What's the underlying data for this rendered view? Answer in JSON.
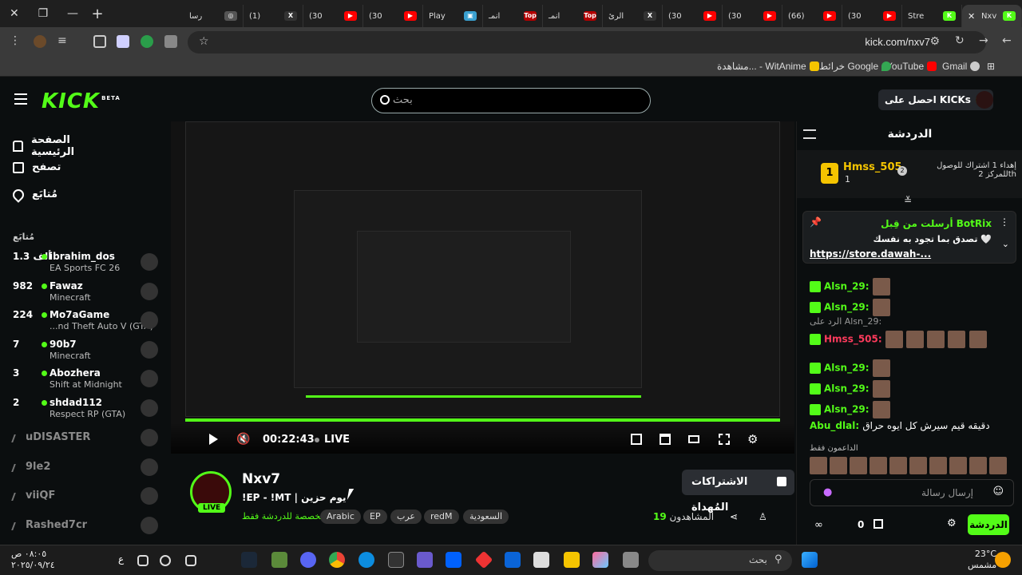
{
  "browser": {
    "tabs": [
      {
        "label": "Nxv",
        "icon": "K",
        "color": "#53fc18",
        "active": true
      },
      {
        "label": "Stre",
        "icon": "K",
        "color": "#53fc18"
      },
      {
        "label": "(30",
        "icon": "▶",
        "color": "#ff0000"
      },
      {
        "label": "(66)",
        "icon": "▶",
        "color": "#ff0000"
      },
      {
        "label": "(30",
        "icon": "▶",
        "color": "#ff0000"
      },
      {
        "label": "(30",
        "icon": "▶",
        "color": "#ff0000"
      },
      {
        "label": "الرئ",
        "icon": "X",
        "color": "#333333"
      },
      {
        "label": "انمـ",
        "icon": "Top",
        "color": "#b30000"
      },
      {
        "label": "انمـ",
        "icon": "Top",
        "color": "#b30000"
      },
      {
        "label": "Play",
        "icon": "▣",
        "color": "#3aa0d0"
      },
      {
        "label": "(30",
        "icon": "▶",
        "color": "#ff0000"
      },
      {
        "label": "(30",
        "icon": "▶",
        "color": "#ff0000"
      },
      {
        "label": "(1)",
        "icon": "X",
        "color": "#333333"
      },
      {
        "label": "رسا",
        "icon": "◎",
        "color": "#555555"
      }
    ],
    "url": "kick.com/nxv7",
    "bookmarks": [
      {
        "label": "Gmail",
        "color": "#cccccc"
      },
      {
        "label": "YouTube",
        "color": "#ff0000"
      },
      {
        "label": "خرائط Google",
        "color": "#34a853"
      },
      {
        "label": "مشاهدة... - WitAnime",
        "color": "#f5c400"
      }
    ]
  },
  "kick": {
    "logo": "KICK",
    "beta": "BETA",
    "search_placeholder": "بحث",
    "get_kicks": "احصل على KICKs"
  },
  "sidebar": {
    "nav": [
      "الصفحة الرئيسية",
      "تصفح",
      "مُتابَع"
    ],
    "following_header": "مُتابَع",
    "live": [
      {
        "name": "ibrahim_dos",
        "count": "1.3 ألف",
        "category": "EA Sports FC 26"
      },
      {
        "name": "Fawaz",
        "count": "982",
        "category": "Minecraft"
      },
      {
        "name": "Mo7aGame",
        "count": "224",
        "category": "...nd Theft Auto V (GTA)"
      },
      {
        "name": "90b7",
        "count": "7",
        "category": "Minecraft"
      },
      {
        "name": "Abozhera",
        "count": "3",
        "category": "Shift at Midnight"
      },
      {
        "name": "shdad112",
        "count": "2",
        "category": "Respect RP (GTA)"
      }
    ],
    "offline": [
      "uDISASTER",
      "9le2",
      "viiQF",
      "Rashed7cr"
    ]
  },
  "player": {
    "time": "00:22:43",
    "live_label": "LIVE"
  },
  "stream": {
    "name": "Nxv7",
    "title": "!EP - !MT | يوم حزين",
    "category": "مخصصة للدردشة فقط",
    "tags": [
      "السعودية",
      "redM",
      "عرب",
      "EP",
      "Arabic"
    ],
    "gift_button": "الاشتراكات المُهداة",
    "viewers_label": "المشاهدون",
    "viewers_count": "19",
    "live_badge": "LIVE"
  },
  "chat": {
    "title": "الدردشة",
    "leader": {
      "name": "Hmss_505",
      "subs": "1",
      "rank": "2",
      "description": "إهداء 1 اشتراك للوصول للمركز 2th"
    },
    "pinned": {
      "author": "BotRix",
      "sent_by": "أرسلت من قِبل",
      "text": "تصدق بما تجود به نفسك 🤍",
      "link": "https://store.dawah-..."
    },
    "messages": [
      {
        "user": "Alsn_29:",
        "color": "#53fc18"
      },
      {
        "user": "Alsn_29:",
        "color": "#53fc18"
      },
      {
        "user": "Hmss_505:",
        "color": "#ff3b5c",
        "reply": "الرد على Alsn_29:"
      },
      {
        "user": "Alsn_29:",
        "color": "#53fc18"
      },
      {
        "user": "Alsn_29:",
        "color": "#53fc18"
      },
      {
        "user": "Alsn_29:",
        "color": "#53fc18"
      },
      {
        "user": "Abu_dlal:",
        "color": "#53fc18",
        "text": "دقيقه قيم سيرش كل ايوه حراق"
      }
    ],
    "supporters_label": "الداعمون فقط",
    "input_placeholder": "إرسال رسالة",
    "send_button": "الدردشة",
    "points": "0"
  },
  "taskbar": {
    "time": "٠٨:٠٥ ص",
    "date": "٢٠٢٥/٠٩/٢٤",
    "search": "بحث",
    "temp": "23°C",
    "weather": "مشمس",
    "lang": "ع"
  }
}
